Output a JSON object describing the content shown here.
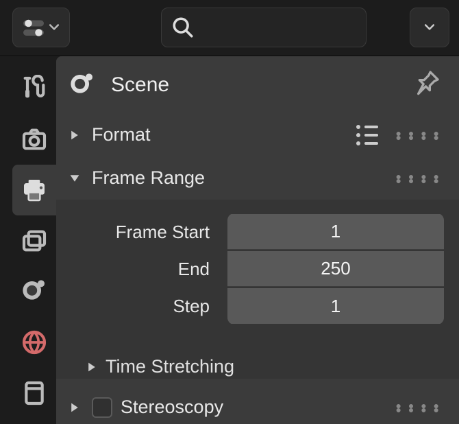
{
  "header": {
    "title": "Scene"
  },
  "sections": {
    "format": {
      "label": "Format"
    },
    "frame_range": {
      "label": "Frame Range",
      "fields": {
        "start": {
          "label": "Frame Start",
          "value": "1"
        },
        "end": {
          "label": "End",
          "value": "250"
        },
        "step": {
          "label": "Step",
          "value": "1"
        }
      },
      "sub": {
        "time_stretching": {
          "label": "Time Stretching"
        }
      }
    },
    "stereoscopy": {
      "label": "Stereoscopy"
    }
  },
  "tabs": [
    "tools",
    "render",
    "output",
    "viewlayer",
    "scene",
    "world",
    "object"
  ]
}
